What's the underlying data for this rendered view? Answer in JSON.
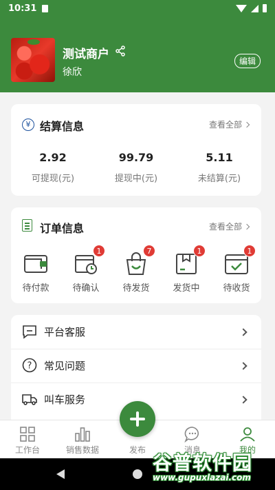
{
  "status_bar": {
    "time": "10:31"
  },
  "profile": {
    "shop_name": "测试商户",
    "user_name": "徐欣",
    "edit_label": "编辑"
  },
  "settlement": {
    "title": "结算信息",
    "view_all": "查看全部",
    "items": [
      {
        "value": "2.92",
        "label": "可提现(元)"
      },
      {
        "value": "99.79",
        "label": "提现中(元)"
      },
      {
        "value": "5.11",
        "label": "未结算(元)"
      }
    ]
  },
  "orders": {
    "title": "订单信息",
    "view_all": "查看全部",
    "items": [
      {
        "label": "待付款",
        "badge": "",
        "icon": "wallet-icon"
      },
      {
        "label": "待确认",
        "badge": "1",
        "icon": "clock-box-icon"
      },
      {
        "label": "待发货",
        "badge": "7",
        "icon": "shopping-bag-icon"
      },
      {
        "label": "发货中",
        "badge": "1",
        "icon": "package-icon"
      },
      {
        "label": "待收货",
        "badge": "1",
        "icon": "check-box-icon"
      }
    ]
  },
  "menu": [
    {
      "label": "平台客服",
      "icon": "chat-box-icon"
    },
    {
      "label": "常见问题",
      "icon": "question-circle-icon"
    },
    {
      "label": "叫车服务",
      "icon": "truck-icon"
    }
  ],
  "tabs": [
    {
      "label": "工作台",
      "icon": "grid-icon"
    },
    {
      "label": "销售数据",
      "icon": "bar-chart-icon"
    },
    {
      "label": "发布",
      "icon": "plus-icon"
    },
    {
      "label": "消息",
      "icon": "message-icon"
    },
    {
      "label": "我的",
      "icon": "person-icon",
      "active": true
    }
  ],
  "watermark": {
    "title": "谷普软件园",
    "url": "www.gupuxlazai.com"
  },
  "colors": {
    "brand_green": "#3c8a3d",
    "badge_red": "#e03b35",
    "settle_blue": "#1a4f9c"
  }
}
